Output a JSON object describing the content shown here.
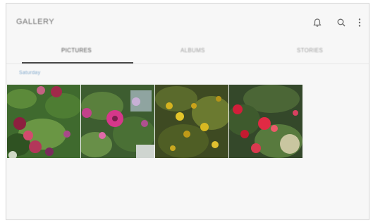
{
  "header": {
    "title": "GALLERY",
    "icons": [
      "bell-icon",
      "search-icon",
      "more-vert-icon"
    ]
  },
  "tabs": [
    {
      "label": "PICTURES",
      "active": true
    },
    {
      "label": "ALBUMS",
      "active": false
    },
    {
      "label": "STORIES",
      "active": false
    }
  ],
  "section": {
    "label": "Saturday"
  },
  "photos": [
    {
      "name": "flower-photo-1",
      "subject": "red and purple flowers with green leaves"
    },
    {
      "name": "flower-photo-2",
      "subject": "pink cosmos flowers in garden"
    },
    {
      "name": "flower-photo-3",
      "subject": "yellow flowering shrub"
    },
    {
      "name": "flower-photo-4",
      "subject": "red flowers and plants"
    }
  ],
  "colors": {
    "accent_blue": "#7fa8cc",
    "tab_active": "#4a4a4a",
    "background": "#f7f7f7"
  }
}
